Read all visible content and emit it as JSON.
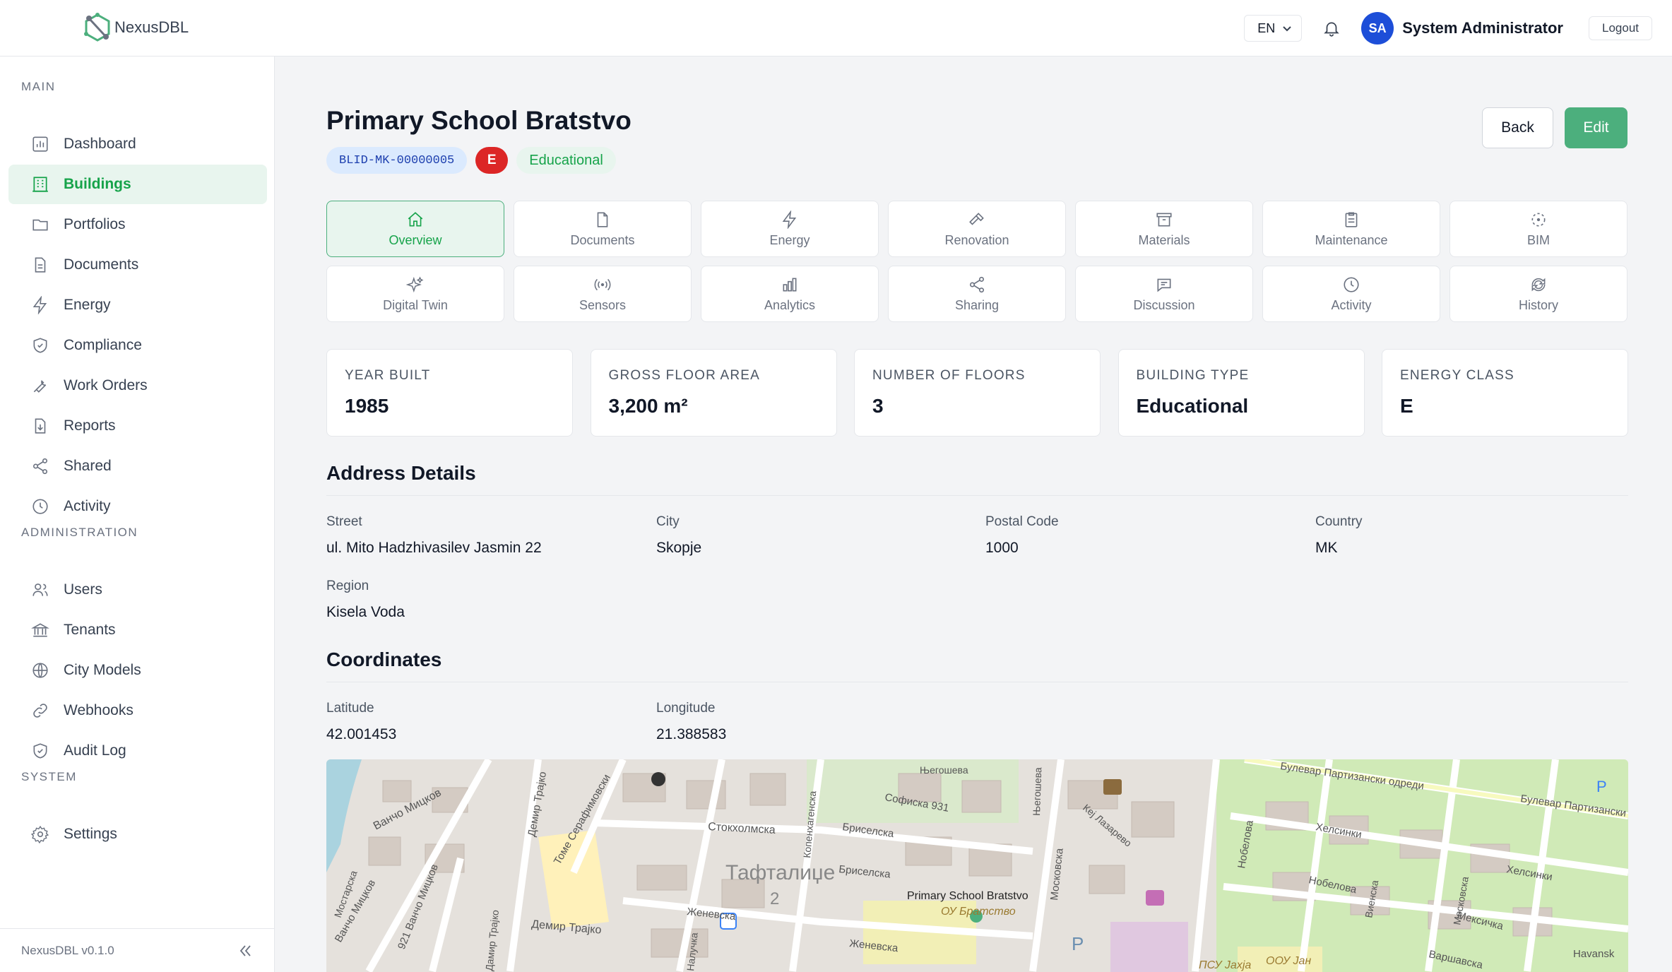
{
  "app": {
    "name": "NexusDBL",
    "version": "NexusDBL v0.1.0"
  },
  "topbar": {
    "language": "EN",
    "user_initials": "SA",
    "user_name": "System Administrator",
    "logout_label": "Logout"
  },
  "sidebar": {
    "sections": {
      "main": "MAIN",
      "administration": "ADMINISTRATION",
      "system": "SYSTEM"
    },
    "main_items": [
      "Dashboard",
      "Buildings",
      "Portfolios",
      "Documents",
      "Energy",
      "Compliance",
      "Work Orders",
      "Reports",
      "Shared",
      "Activity"
    ],
    "admin_items": [
      "Users",
      "Tenants",
      "City Models",
      "Webhooks",
      "Audit Log"
    ],
    "system_items": [
      "Settings"
    ],
    "active_item": "Buildings"
  },
  "building": {
    "title": "Primary School Bratstvo",
    "id_badge": "BLID-MK-00000005",
    "energy_badge": "E",
    "type_badge": "Educational",
    "back_label": "Back",
    "edit_label": "Edit"
  },
  "tabs": [
    "Overview",
    "Documents",
    "Energy",
    "Renovation",
    "Materials",
    "Maintenance",
    "BIM",
    "Digital Twin",
    "Sensors",
    "Analytics",
    "Sharing",
    "Discussion",
    "Activity",
    "History"
  ],
  "stats": [
    {
      "label": "YEAR BUILT",
      "value": "1985"
    },
    {
      "label": "GROSS FLOOR AREA",
      "value": "3,200 m²"
    },
    {
      "label": "NUMBER OF FLOORS",
      "value": "3"
    },
    {
      "label": "BUILDING TYPE",
      "value": "Educational"
    },
    {
      "label": "ENERGY CLASS",
      "value": "E"
    }
  ],
  "address": {
    "title": "Address Details",
    "street_label": "Street",
    "street": "ul. Mito Hadzhivasilev Jasmin 22",
    "city_label": "City",
    "city": "Skopje",
    "postal_label": "Postal Code",
    "postal": "1000",
    "country_label": "Country",
    "country": "MK",
    "region_label": "Region",
    "region": "Kisela Voda"
  },
  "coordinates": {
    "title": "Coordinates",
    "lat_label": "Latitude",
    "lat": "42.001453",
    "lon_label": "Longitude",
    "lon": "21.388583"
  },
  "map": {
    "labels": [
      "Ванчо Мицков",
      "Демир Трајко",
      "Томе Серафимовски",
      "Стокхолмска",
      "Тафталиџе",
      "2",
      "Копенхагенска",
      "Софиска 931",
      "Бриселска",
      "Бриселска",
      "Primary School Bratstvo",
      "ОУ Братство",
      "Женевска",
      "Женевска",
      "Демир Трајко",
      "Московска",
      "Његошева",
      "Његошева",
      "Кеј Лазарево",
      "Булевар Партизански одреди",
      "Булевар Партизански",
      "Хелсинки",
      "Хелсинки",
      "Нобелова",
      "Нобелова",
      "Виенска",
      "Мексичка",
      "Варшавска",
      "Московска",
      "Havansk",
      "ПСУ Јахја",
      "ООУ Јан",
      "921 Ванчо Мицков",
      "Ванчо Мицков",
      "Дамир Трајко",
      "Налучка",
      "P",
      "P",
      "Мостарска"
    ]
  }
}
